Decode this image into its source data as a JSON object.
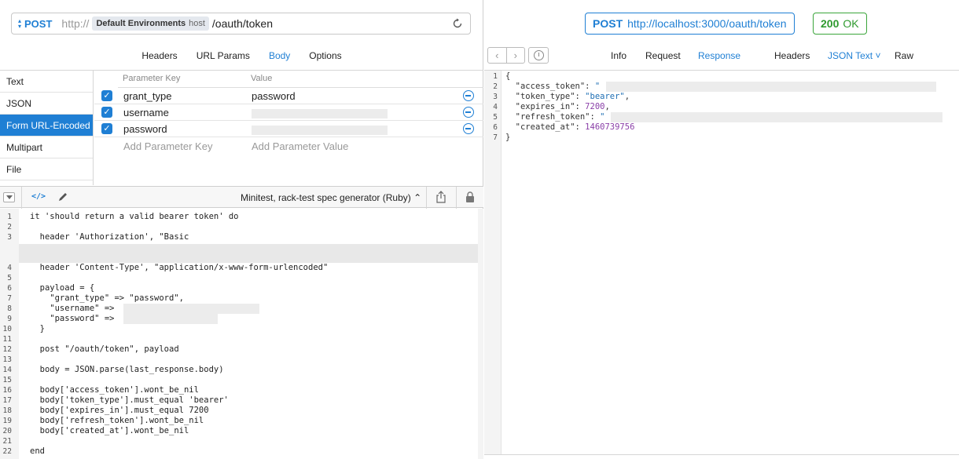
{
  "request": {
    "method": "POST",
    "url_scheme": "http://",
    "environment_name": "Default Environments",
    "environment_var": "host",
    "url_path": "/oauth/token",
    "tabs": [
      {
        "label": "Headers",
        "active": false
      },
      {
        "label": "URL Params",
        "active": false
      },
      {
        "label": "Body",
        "active": true
      },
      {
        "label": "Options",
        "active": false
      }
    ],
    "body_types": [
      {
        "label": "Text",
        "active": false
      },
      {
        "label": "JSON",
        "active": false
      },
      {
        "label": "Form URL-Encoded",
        "active": true
      },
      {
        "label": "Multipart",
        "active": false
      },
      {
        "label": "File",
        "active": false
      }
    ],
    "params_header": {
      "key": "Parameter Key",
      "value": "Value"
    },
    "params": [
      {
        "key": "grant_type",
        "value": "password",
        "enabled": true
      },
      {
        "key": "username",
        "value": "",
        "enabled": true
      },
      {
        "key": "password",
        "value": "",
        "enabled": true
      }
    ],
    "add_key_placeholder": "Add Parameter Key",
    "add_value_placeholder": "Add Parameter Value",
    "check_glyph": "✓"
  },
  "generator": {
    "code_icon": "</>",
    "selected": "Minitest, rack-test spec generator (Ruby)",
    "select_glyph": "⌃",
    "lines": [
      {
        "n": "1",
        "text": "it 'should return a valid bearer token' do"
      },
      {
        "n": "2",
        "text": ""
      },
      {
        "n": "3",
        "text": "  header 'Authorization', \"Basic"
      },
      {
        "n": "4",
        "text": "  header 'Content-Type', \"application/x-www-form-urlencoded\""
      },
      {
        "n": "5",
        "text": ""
      },
      {
        "n": "6",
        "text": "  payload = {"
      },
      {
        "n": "7",
        "text": "    \"grant_type\" => \"password\","
      },
      {
        "n": "8",
        "text": "    \"username\" =>                           ,"
      },
      {
        "n": "9",
        "text": "    \"password\" =>                    ,"
      },
      {
        "n": "10",
        "text": "  }"
      },
      {
        "n": "11",
        "text": ""
      },
      {
        "n": "12",
        "text": "  post \"/oauth/token\", payload"
      },
      {
        "n": "13",
        "text": ""
      },
      {
        "n": "14",
        "text": "  body = JSON.parse(last_response.body)"
      },
      {
        "n": "15",
        "text": ""
      },
      {
        "n": "16",
        "text": "  body['access_token'].wont_be_nil"
      },
      {
        "n": "17",
        "text": "  body['token_type'].must_equal 'bearer'"
      },
      {
        "n": "18",
        "text": "  body['expires_in'].must_equal 7200"
      },
      {
        "n": "19",
        "text": "  body['refresh_token'].wont_be_nil"
      },
      {
        "n": "20",
        "text": "  body['created_at'].wont_be_nil"
      },
      {
        "n": "21",
        "text": ""
      },
      {
        "n": "22",
        "text": "end"
      }
    ]
  },
  "response": {
    "method": "POST",
    "url": "http://localhost:3000/oauth/token",
    "status_code": "200",
    "status_text": "OK",
    "nav_back": "‹",
    "nav_forward": "›",
    "tabs": {
      "info": "Info",
      "request": "Request",
      "response": "Response",
      "headers": "Headers",
      "json_text": "JSON Text ˅",
      "raw": "Raw"
    },
    "json_lines": [
      {
        "n": "1",
        "text": "{"
      },
      {
        "n": "2",
        "key": "\"access_token\"",
        "sep": ": ",
        "val": "\"                                                \"",
        "tail": ",",
        "type": "str"
      },
      {
        "n": "3",
        "key": "\"token_type\"",
        "sep": ": ",
        "val": "\"bearer\"",
        "tail": ",",
        "type": "str"
      },
      {
        "n": "4",
        "key": "\"expires_in\"",
        "sep": ": ",
        "val": "7200",
        "tail": ",",
        "type": "num"
      },
      {
        "n": "5",
        "key": "\"refresh_token\"",
        "sep": ": ",
        "val": "\"                                                \"",
        "tail": ",",
        "type": "str"
      },
      {
        "n": "6",
        "key": "\"created_at\"",
        "sep": ": ",
        "val": "1460739756",
        "tail": "",
        "type": "num"
      },
      {
        "n": "7",
        "text": "}"
      }
    ]
  },
  "colors": {
    "accent": "#1f7fd4",
    "status_ok": "#2f9a2f"
  },
  "icons": [
    "reload-icon",
    "code-icon",
    "pencil-icon",
    "share-icon",
    "lock-icon",
    "history-icon",
    "remove-param-icon",
    "checkbox-checked-icon"
  ]
}
